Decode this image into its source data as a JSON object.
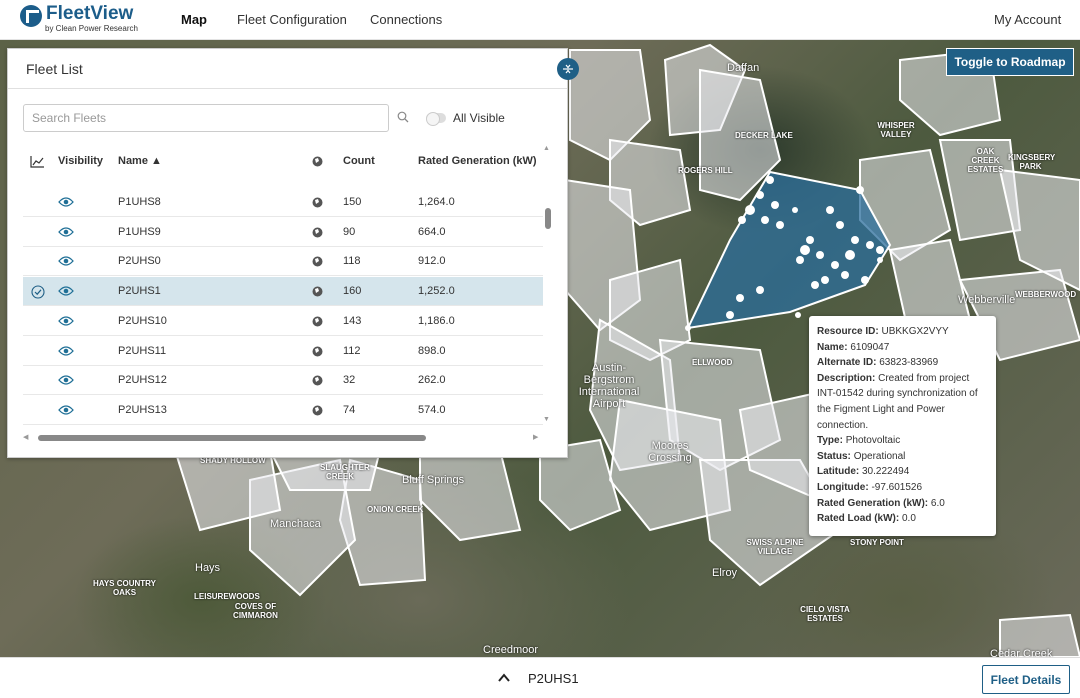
{
  "app": {
    "brand": "FleetView",
    "brand_sub": "by Clean Power Research"
  },
  "nav": {
    "map": "Map",
    "fleet_configuration": "Fleet Configuration",
    "connections": "Connections",
    "my_account": "My Account"
  },
  "map": {
    "toggle_roadmap": "Toggle to Roadmap",
    "labels": [
      {
        "text": "Daffan",
        "cls": "big"
      },
      {
        "text": "Manchaca",
        "cls": "big"
      },
      {
        "text": "Bluff Springs",
        "cls": "big"
      },
      {
        "text": "Moores Crossing",
        "cls": "big"
      },
      {
        "text": "Hays",
        "cls": "big"
      },
      {
        "text": "Elroy",
        "cls": "big"
      },
      {
        "text": "Creedmoor",
        "cls": "big"
      },
      {
        "text": "Webberville",
        "cls": "big"
      },
      {
        "text": "Cedar Creek",
        "cls": "big"
      },
      {
        "text": "Austin-Bergstrom International Airport",
        "cls": "big"
      },
      {
        "text": "SHADY HOLLOW",
        "cls": ""
      },
      {
        "text": "HAYS COUNTRY OAKS",
        "cls": ""
      },
      {
        "text": "LEISUREWOODS",
        "cls": ""
      },
      {
        "text": "COVES OF CIMMARON",
        "cls": ""
      },
      {
        "text": "ONION CREEK",
        "cls": ""
      },
      {
        "text": "SWISS ALPINE VILLAGE",
        "cls": ""
      },
      {
        "text": "OAK CREEK ESTATES",
        "cls": ""
      },
      {
        "text": "KINGSBERY PARK",
        "cls": ""
      },
      {
        "text": "WHISPER VALLEY",
        "cls": ""
      },
      {
        "text": "DECKER LAKE",
        "cls": ""
      },
      {
        "text": "ROGERS HILL",
        "cls": ""
      },
      {
        "text": "WEBBERWOOD",
        "cls": ""
      },
      {
        "text": "CIELO VISTA ESTATES",
        "cls": ""
      },
      {
        "text": "STONY POINT",
        "cls": ""
      },
      {
        "text": "SLAUGHTER CREEK",
        "cls": ""
      },
      {
        "text": "ELLWOOD",
        "cls": ""
      }
    ]
  },
  "fleet_list": {
    "title": "Fleet List",
    "search_placeholder": "Search Fleets",
    "all_visible": "All Visible",
    "columns": {
      "visibility": "Visibility",
      "name": "Name ▲",
      "count": "Count",
      "rated_generation": "Rated Generation (kW)"
    },
    "rows": [
      {
        "name": "P1UHS8",
        "count": "150",
        "rated": "1,264.0",
        "selected": false
      },
      {
        "name": "P1UHS9",
        "count": "90",
        "rated": "664.0",
        "selected": false
      },
      {
        "name": "P2UHS0",
        "count": "118",
        "rated": "912.0",
        "selected": false
      },
      {
        "name": "P2UHS1",
        "count": "160",
        "rated": "1,252.0",
        "selected": true
      },
      {
        "name": "P2UHS10",
        "count": "143",
        "rated": "1,186.0",
        "selected": false
      },
      {
        "name": "P2UHS11",
        "count": "112",
        "rated": "898.0",
        "selected": false
      },
      {
        "name": "P2UHS12",
        "count": "32",
        "rated": "262.0",
        "selected": false
      },
      {
        "name": "P2UHS13",
        "count": "74",
        "rated": "574.0",
        "selected": false
      }
    ]
  },
  "tooltip": {
    "resource_id_label": "Resource ID:",
    "resource_id": "UBKKGX2VYY",
    "name_label": "Name:",
    "name": "6109047",
    "alt_id_label": "Alternate ID:",
    "alt_id": "63823-83969",
    "description_label": "Description:",
    "description": "Created from project INT-01542 during synchronization of the Figment Light and Power connection.",
    "type_label": "Type:",
    "type": "Photovoltaic",
    "status_label": "Status:",
    "status": "Operational",
    "latitude_label": "Latitude:",
    "latitude": "30.222494",
    "longitude_label": "Longitude:",
    "longitude": "-97.601526",
    "rated_gen_label": "Rated Generation (kW):",
    "rated_gen": "6.0",
    "rated_load_label": "Rated Load (kW):",
    "rated_load": "0.0"
  },
  "bottom": {
    "selected_fleet": "P2UHS1",
    "fleet_details": "Fleet Details"
  },
  "colors": {
    "brand": "#1c5d8a",
    "accent": "#1f5f86",
    "selected_row": "#d5e5ec",
    "selected_polygon": "#2b6e9c"
  }
}
